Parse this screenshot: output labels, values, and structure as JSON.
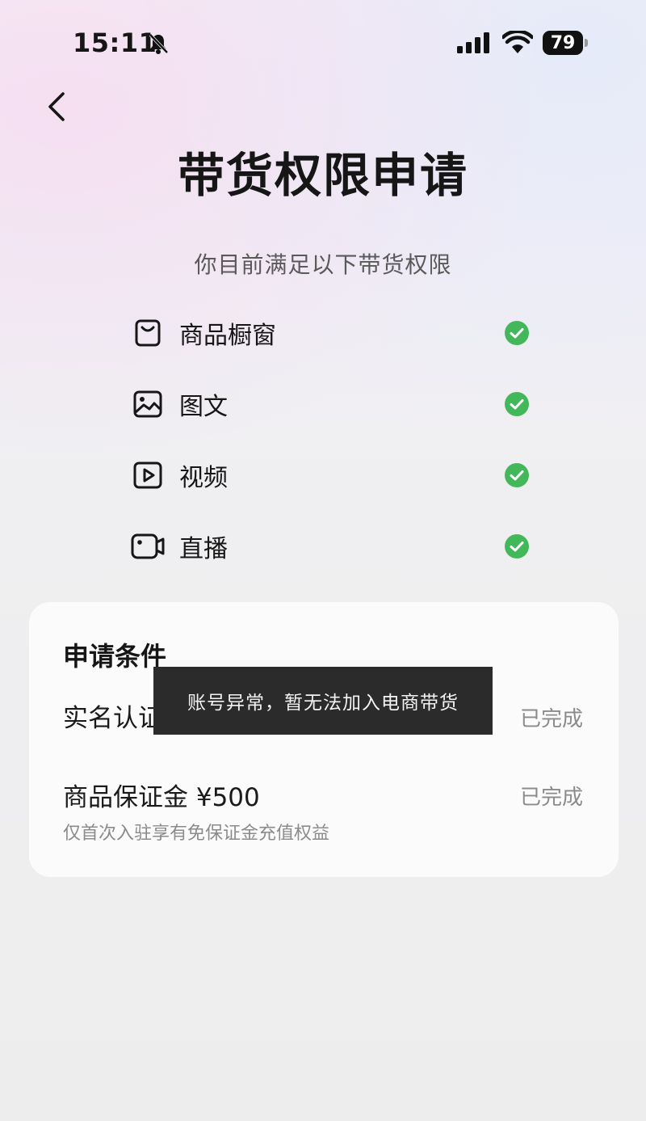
{
  "status_bar": {
    "time": "15:11",
    "battery": "79",
    "icons": [
      "bell-muted-icon",
      "cellular-signal-icon",
      "wifi-icon",
      "battery-icon"
    ]
  },
  "header": {
    "back_icon": "chevron-left-icon",
    "title": "带货权限申请",
    "subtitle": "你目前满足以下带货权限"
  },
  "permissions": [
    {
      "label": "商品橱窗",
      "icon": "showcase-bag-icon",
      "status_icon": "check-circle-icon"
    },
    {
      "label": "图文",
      "icon": "image-icon",
      "status_icon": "check-circle-icon"
    },
    {
      "label": "视频",
      "icon": "video-play-icon",
      "status_icon": "check-circle-icon"
    },
    {
      "label": "直播",
      "icon": "camera-live-icon",
      "status_icon": "check-circle-icon"
    }
  ],
  "conditions": {
    "title": "申请条件",
    "items": [
      {
        "label": "实名认证",
        "status": "已完成"
      },
      {
        "label": "商品保证金 ¥500",
        "status": "已完成",
        "note": "仅首次入驻享有免保证金充值权益"
      }
    ]
  },
  "toast": {
    "message": "账号异常，暂无法加入电商带货"
  },
  "colors": {
    "check_green": "#43b85a",
    "toast_bg": "#2b2b2b",
    "muted_text": "#8b8b8b"
  }
}
